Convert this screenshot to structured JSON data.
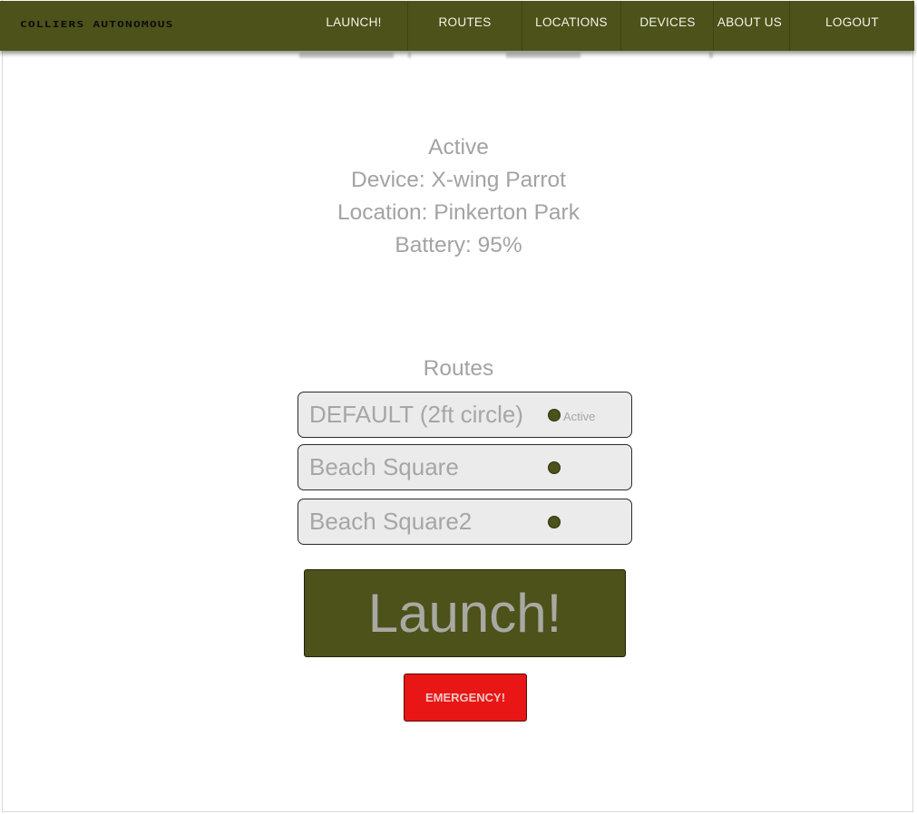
{
  "app": {
    "logo_text": "COLLIERS AUTONOMOUS",
    "brand_color": "#4c5219",
    "danger_color": "#e81614"
  },
  "nav": {
    "items": [
      {
        "label": "LAUNCH!"
      },
      {
        "label": "ROUTES"
      },
      {
        "label": "LOCATIONS"
      },
      {
        "label": "DEVICES"
      },
      {
        "label": "ABOUT US"
      },
      {
        "label": "LOGOUT"
      }
    ]
  },
  "status": {
    "state": "Active",
    "device": "Device: X-wing Parrot",
    "location": "Location: Pinkerton Park",
    "battery": "Battery: 95%"
  },
  "routes": {
    "title": "Routes",
    "items": [
      {
        "name": "DEFAULT (2ft circle)",
        "badge": "Active"
      },
      {
        "name": "Beach Square",
        "badge": ""
      },
      {
        "name": "Beach Square2",
        "badge": ""
      }
    ]
  },
  "actions": {
    "launch_label": "Launch!",
    "emergency_label": "EMERGENCY!"
  }
}
